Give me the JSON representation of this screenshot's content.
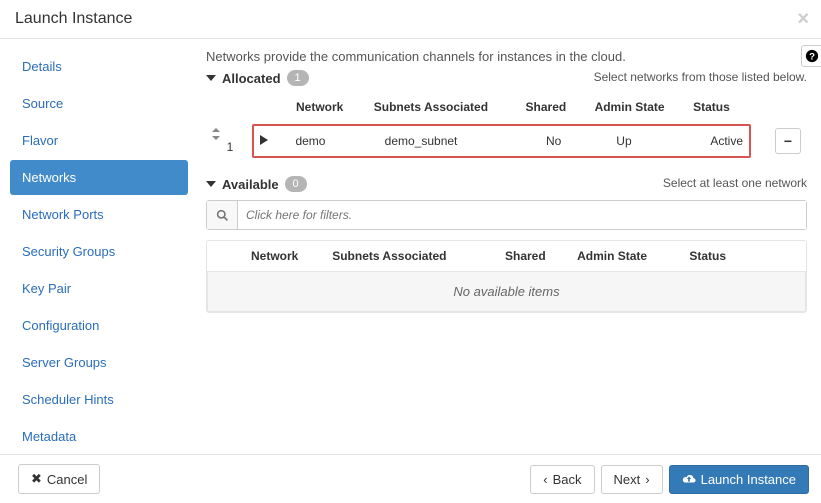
{
  "header": {
    "title": "Launch Instance"
  },
  "sidebar": {
    "items": [
      {
        "label": "Details"
      },
      {
        "label": "Source"
      },
      {
        "label": "Flavor"
      },
      {
        "label": "Networks"
      },
      {
        "label": "Network Ports"
      },
      {
        "label": "Security Groups"
      },
      {
        "label": "Key Pair"
      },
      {
        "label": "Configuration"
      },
      {
        "label": "Server Groups"
      },
      {
        "label": "Scheduler Hints"
      },
      {
        "label": "Metadata"
      }
    ],
    "active_index": 3
  },
  "content": {
    "description": "Networks provide the communication channels for instances in the cloud.",
    "allocated": {
      "label": "Allocated",
      "count": "1",
      "hint": "Select networks from those listed below.",
      "columns": [
        "Network",
        "Subnets Associated",
        "Shared",
        "Admin State",
        "Status"
      ],
      "rows": [
        {
          "order": "1",
          "network": "demo",
          "subnets": "demo_subnet",
          "shared": "No",
          "admin_state": "Up",
          "status": "Active"
        }
      ]
    },
    "available": {
      "label": "Available",
      "count": "0",
      "hint": "Select at least one network",
      "filter_placeholder": "Click here for filters.",
      "columns": [
        "Network",
        "Subnets Associated",
        "Shared",
        "Admin State",
        "Status"
      ],
      "empty_text": "No available items"
    }
  },
  "footer": {
    "cancel": "Cancel",
    "back": "Back",
    "next": "Next",
    "launch": "Launch Instance"
  }
}
